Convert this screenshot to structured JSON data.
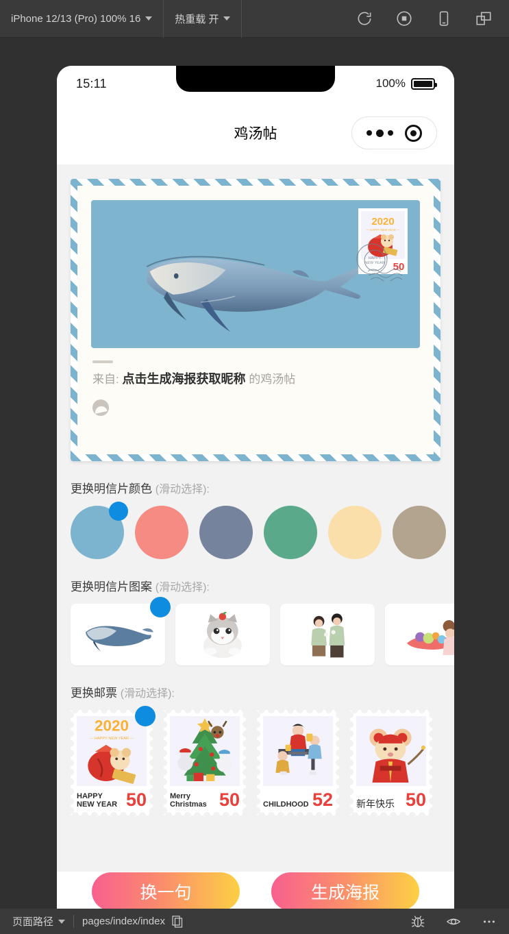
{
  "devtools": {
    "device_selector": "iPhone 12/13 (Pro) 100% 16",
    "hot_reload": "热重载 开",
    "icons": [
      "refresh-icon",
      "stop-icon",
      "device-icon",
      "multi-window-icon"
    ],
    "bottom": {
      "path_label": "页面路径",
      "path_value": "pages/index/index",
      "icons": [
        "bug-icon",
        "eye-icon",
        "more-icon"
      ]
    }
  },
  "phone": {
    "status": {
      "time": "15:11",
      "battery_pct": "100%"
    },
    "nav": {
      "title": "鸡汤帖",
      "capsule_menu": "more-dots-icon",
      "capsule_target": "target-icon"
    }
  },
  "postcard": {
    "photo_bg": "#7eb4ce",
    "illustration": "whale-illustration",
    "stamp": {
      "year": "2020",
      "greeting": "HAPPY NEW YEAR",
      "price": "50",
      "postmark": "HAPPY NEW YEAR"
    },
    "from_prefix": "来自:",
    "from_name": "点击生成海报获取昵称",
    "from_suffix": "的鸡汤帖"
  },
  "sections": {
    "color": {
      "title": "更换明信片颜色",
      "hint": "(滑动选择):",
      "selected_index": 0,
      "swatches": [
        {
          "name": "light-blue",
          "hex": "#7cb4cf"
        },
        {
          "name": "salmon-red",
          "hex": "#f58b82"
        },
        {
          "name": "slate-blue",
          "hex": "#76839d"
        },
        {
          "name": "sea-green",
          "hex": "#5aa98a"
        },
        {
          "name": "light-peach",
          "hex": "#fbdfab"
        },
        {
          "name": "warm-taupe",
          "hex": "#b3a490"
        }
      ]
    },
    "pattern": {
      "title": "更换明信片图案",
      "hint": "(滑动选择):",
      "selected_index": 0,
      "items": [
        {
          "name": "whale-pattern"
        },
        {
          "name": "cat-pattern"
        },
        {
          "name": "couple-pattern"
        },
        {
          "name": "picnic-pattern"
        }
      ]
    },
    "stamp": {
      "title": "更换邮票",
      "hint": "(滑动选择):",
      "selected_index": 0,
      "items": [
        {
          "name": "new-year-2020-stamp",
          "label": "HAPPY\nNEW YEAR",
          "price": "50",
          "art": "mouse-2020"
        },
        {
          "name": "christmas-stamp",
          "label": "Merry\nChristmas",
          "price": "50",
          "art": "christmas-tree"
        },
        {
          "name": "childhood-stamp",
          "label": "CHILDHOOD",
          "price": "52",
          "art": "childhood"
        },
        {
          "name": "cny-stamp",
          "label": "新年快乐",
          "price": "50",
          "art": "mouse-firecracker"
        }
      ]
    }
  },
  "actions": {
    "refresh_quote": "换一句",
    "generate_poster": "生成海报",
    "gradient_from": "#f8608f",
    "gradient_to": "#fdd044"
  },
  "accent": {
    "badge": "#0e8ce0"
  }
}
